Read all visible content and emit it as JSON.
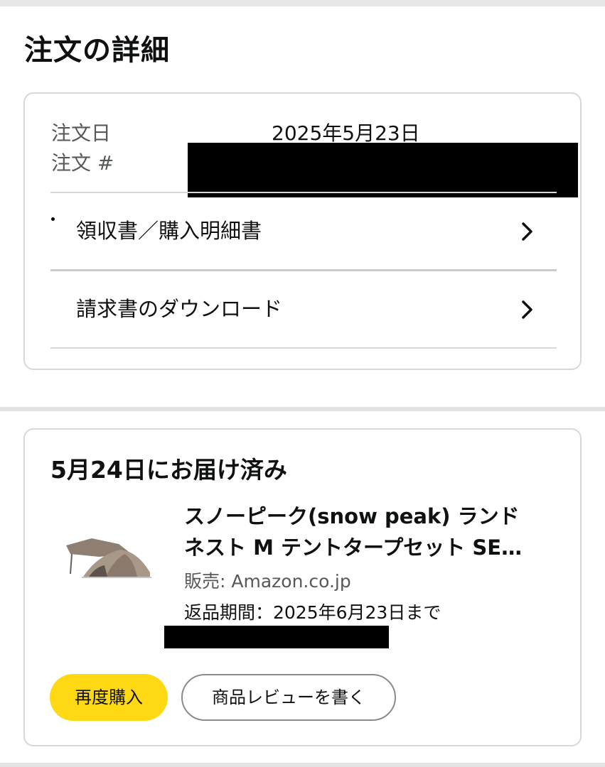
{
  "page": {
    "title": "注文の詳細"
  },
  "order": {
    "date_label": "注文日",
    "date_value": "2025年5月23日",
    "number_label": "注文 #",
    "links": [
      {
        "label": "領収書／購入明細書",
        "icon": "chevron-right-icon"
      },
      {
        "label": "請求書のダウンロード",
        "icon": "chevron-right-icon"
      }
    ]
  },
  "shipment": {
    "status": "5月24日にお届け済み",
    "product": {
      "title_line1": "スノーピーク(snow peak) ランド",
      "title_line2": "ネスト M テントタープセット SE…",
      "seller": "販売: Amazon.co.jp",
      "return_period": "返品期間：2025年6月23日まで",
      "thumbnail_icon": "tent-product-image"
    },
    "buttons": {
      "buy_again": "再度購入",
      "write_review": "商品レビューを書く"
    }
  },
  "colors": {
    "buy_again_bg": "#ffd814",
    "border": "#d5d9d9",
    "secondary_text": "#565959"
  }
}
